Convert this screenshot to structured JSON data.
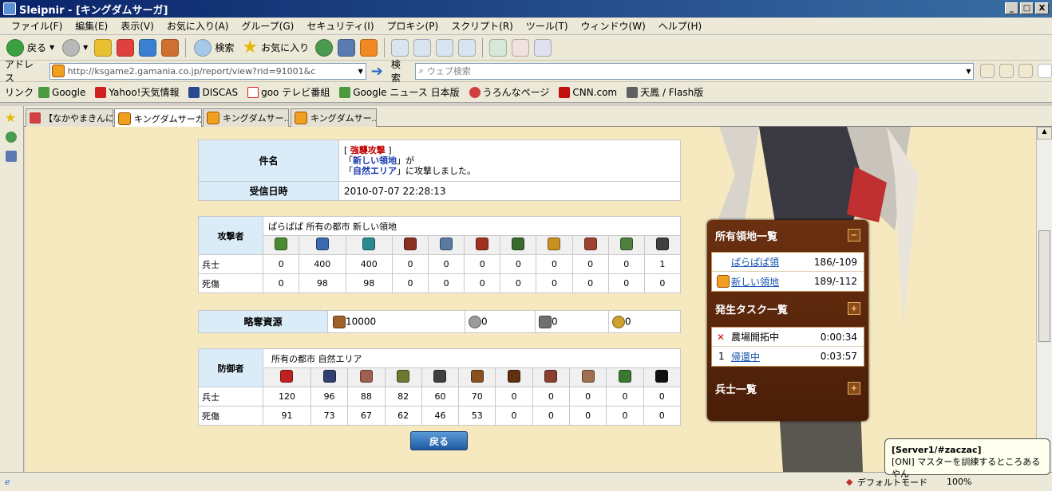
{
  "window": {
    "title": "Sleipnir - [キングダムサーガ]",
    "btn_min": "_",
    "btn_max": "□",
    "btn_close": "X"
  },
  "menu": [
    "ファイル(F)",
    "編集(E)",
    "表示(V)",
    "お気に入り(A)",
    "グループ(G)",
    "セキュリティ(I)",
    "プロキシ(P)",
    "スクリプト(R)",
    "ツール(T)",
    "ウィンドウ(W)",
    "ヘルプ(H)"
  ],
  "toolbar": {
    "back": "戻る",
    "search": "検索",
    "favorites": "お気に入り"
  },
  "address": {
    "label": "アドレス",
    "url": "http://ksgame2.gamania.co.jp/report/view?rid=91001&c",
    "search_label": "検索",
    "search_placeholder": "ウェブ検索"
  },
  "links": {
    "label": "リンク",
    "items": [
      "Google",
      "Yahoo!天気情報",
      "DISCAS",
      "goo テレビ番組",
      "Google ニュース 日本版",
      "うろんなページ",
      "CNN.com",
      "天鳳 / Flash版"
    ]
  },
  "tabs": [
    "【なかやまきんに...",
    "キングダムサーガ",
    "キングダムサー...",
    "キングダムサー..."
  ],
  "report": {
    "subject_label": "件名",
    "subject_line1_pre": "[",
    "subject_tag": "強襲攻撃",
    "subject_line1_post": "]",
    "subject_line2_pre": "「",
    "subject_from": "新しい領地",
    "subject_line2_post": "」が",
    "subject_line3_pre": "「",
    "subject_to": "自然エリア",
    "subject_line3_post": "」に攻撃しました。",
    "date_label": "受信日時",
    "date_value": "2010-07-07 22:28:13"
  },
  "attacker": {
    "label": "攻撃者",
    "info": "ぱらぱぱ  所有の都市  新しい領地",
    "icon_colors": [
      "#4a8a30",
      "#3a6ab0",
      "#2a8a90",
      "#8a3020",
      "#5a7aa0",
      "#a03020",
      "#3a6a30",
      "#c89020",
      "#a04030",
      "#508040",
      "#404040"
    ],
    "rows": [
      {
        "label": "兵士",
        "values": [
          "0",
          "400",
          "400",
          "0",
          "0",
          "0",
          "0",
          "0",
          "0",
          "0",
          "1"
        ]
      },
      {
        "label": "死傷",
        "values": [
          "0",
          "98",
          "98",
          "0",
          "0",
          "0",
          "0",
          "0",
          "0",
          "0",
          "0"
        ]
      }
    ]
  },
  "loot": {
    "label": "略奪資源",
    "wood": "10000",
    "stone": "0",
    "iron": "0",
    "food": "0"
  },
  "defender": {
    "label": "防御者",
    "info": "所有の都市  自然エリア",
    "icon_colors": [
      "#c02020",
      "#304070",
      "#a06050",
      "#6a7a30",
      "#404040",
      "#8a5020",
      "#603010",
      "#8a4030",
      "#a07050",
      "#3a7a30",
      "#101010"
    ],
    "rows": [
      {
        "label": "兵士",
        "values": [
          "120",
          "96",
          "88",
          "82",
          "60",
          "70",
          "0",
          "0",
          "0",
          "0",
          "0"
        ]
      },
      {
        "label": "死傷",
        "values": [
          "91",
          "73",
          "67",
          "62",
          "46",
          "53",
          "0",
          "0",
          "0",
          "0",
          "0"
        ]
      }
    ]
  },
  "back_button": "戻る",
  "panel": {
    "territories_title": "所有領地一覧",
    "territories": [
      {
        "name": "ぱらぱぱ領",
        "coord": "186/-109"
      },
      {
        "name": "新しい領地",
        "coord": "189/-112"
      }
    ],
    "tasks_title": "発生タスク一覧",
    "tasks": [
      {
        "prefix": "✕",
        "name": "農場開拓中",
        "time": "0:00:34"
      },
      {
        "prefix": "1",
        "name": "帰還中",
        "time": "0:03:57"
      }
    ],
    "soldiers_title": "兵士一覧"
  },
  "tooltip": {
    "title": "[Server1/#zaczac]",
    "body": "[ONI] マスターを訓練するところあるやん"
  },
  "status": {
    "mode": "デフォルトモード",
    "zoom": "100%"
  }
}
